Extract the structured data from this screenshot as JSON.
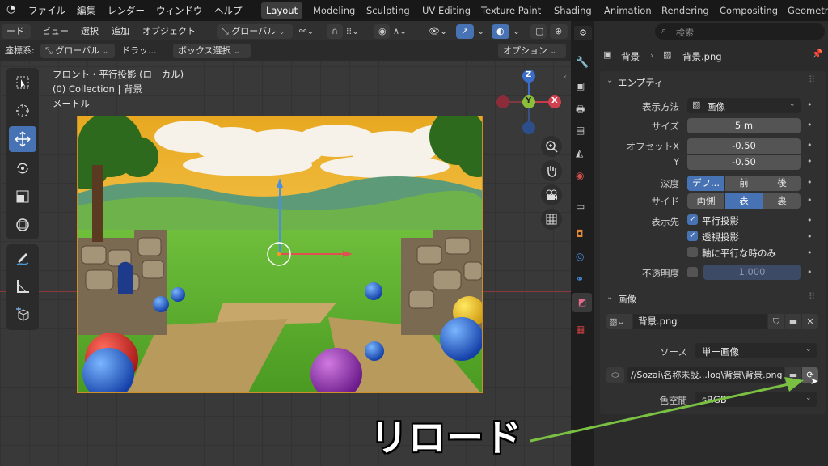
{
  "menu": {
    "file": "ファイル",
    "edit": "編集",
    "render": "レンダー",
    "window": "ウィンドウ",
    "help": "ヘルプ"
  },
  "workspaces": [
    "Layout",
    "Modeling",
    "Sculpting",
    "UV Editing",
    "Texture Paint",
    "Shading",
    "Animation",
    "Rendering",
    "Compositing",
    "Geometry"
  ],
  "viewport_header": {
    "mode": "ード",
    "view": "ビュー",
    "select": "選択",
    "add": "追加",
    "object": "オブジェクト",
    "orientation": "グローバル",
    "coord_label": "座標系:",
    "coord_value": "グローバル",
    "drag_label": "ドラッ...",
    "drag_value": "ボックス選択",
    "options": "オプション"
  },
  "overlay": {
    "line1": "フロント・平行投影 (ローカル)",
    "line2": "(0) Collection | 背景",
    "line3": "メートル"
  },
  "gizmo": {
    "z": "Z",
    "y": "Y",
    "x": "X"
  },
  "search_placeholder": "検索",
  "breadcrumb": {
    "object": "背景",
    "data": "背景.png"
  },
  "empty_panel": {
    "title": "エンプティ",
    "display_label": "表示方法",
    "display_value": "画像",
    "size_label": "サイズ",
    "size_value": "5 m",
    "offset_x_label": "オフセットX",
    "offset_x_value": "-0.50",
    "offset_y_label": "Y",
    "offset_y_value": "-0.50",
    "depth_label": "深度",
    "depth_options": [
      "デフ...",
      "前",
      "後"
    ],
    "side_label": "サイド",
    "side_options": [
      "両側",
      "表",
      "裏"
    ],
    "show_label": "表示先",
    "show_ortho": "平行投影",
    "show_persp": "透視投影",
    "show_axis": "軸に平行な時のみ",
    "opacity_label": "不透明度",
    "opacity_value": "1.000"
  },
  "image_panel": {
    "title": "画像",
    "image_name": "背景.png",
    "source_label": "ソース",
    "source_value": "単一画像",
    "filepath": "//Sozai\\名称未設...log\\背景\\背景.png",
    "colorspace_label": "色空間",
    "colorspace_value": "sRGB"
  },
  "caption": "リロード",
  "colors": {
    "accent": "#4772b3",
    "arrow": "#7ac143",
    "border_image": "#c9902a"
  }
}
